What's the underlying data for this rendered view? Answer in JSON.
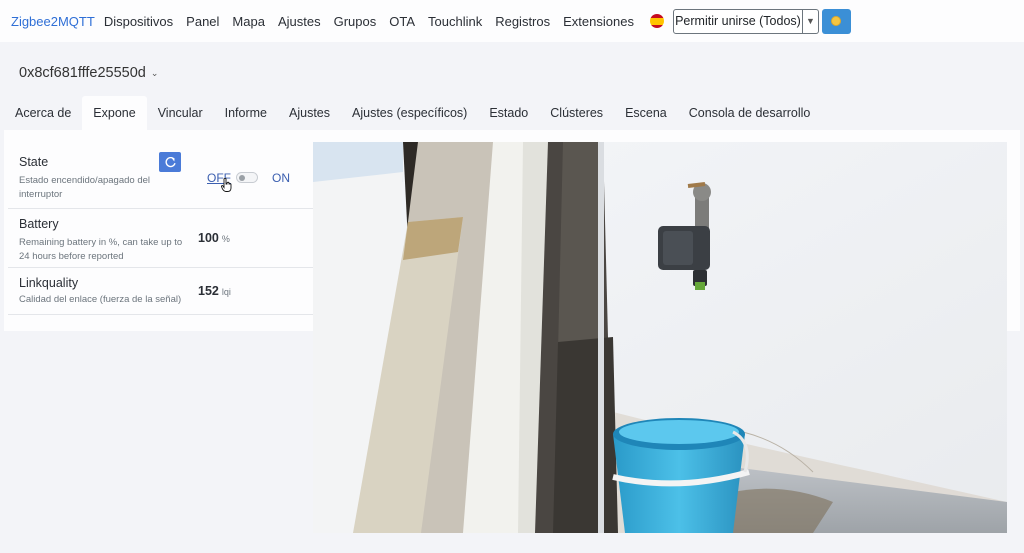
{
  "navbar": {
    "brand": "Zigbee2MQTT",
    "links": [
      "Dispositivos",
      "Panel",
      "Mapa",
      "Ajustes",
      "Grupos",
      "OTA",
      "Touchlink",
      "Registros",
      "Extensiones"
    ],
    "permit_join": "Permitir unirse (Todos)"
  },
  "device": {
    "title": "0x8cf681fffe25550d"
  },
  "tabs": [
    "Acerca de",
    "Expone",
    "Vincular",
    "Informe",
    "Ajustes",
    "Ajustes (específicos)",
    "Estado",
    "Clústeres",
    "Escena",
    "Consola de desarrollo"
  ],
  "active_tab": "Expone",
  "features": {
    "state": {
      "name": "State",
      "desc_line1": "Estado encendido/apagado del",
      "desc_line2": "interruptor",
      "off": "OFF",
      "on": "ON",
      "value": "OFF"
    },
    "battery": {
      "name": "Battery",
      "desc_line1": "Remaining battery in %, can take up to",
      "desc_line2": "24 hours before reported",
      "value": "100",
      "unit": "%"
    },
    "linkquality": {
      "name": "Linkquality",
      "desc": "Calidad del enlace (fuerza de la señal)",
      "value": "152",
      "unit": "lqi"
    }
  },
  "colors": {
    "brand": "#2f6fd6",
    "primary_button": "#4a7bd8",
    "theme_button": "#3b8fd6"
  }
}
